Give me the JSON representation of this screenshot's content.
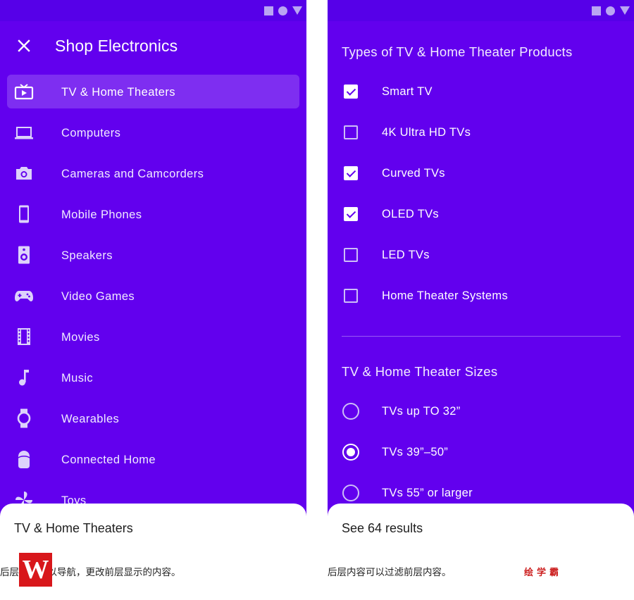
{
  "colors": {
    "primary": "#6200ee",
    "status_bar": "#5600e8",
    "sheet": "#ffffff",
    "watermark_red": "#d8171b"
  },
  "status_icons": [
    "square-icon",
    "circle-icon",
    "triangle-icon"
  ],
  "left_panel": {
    "title": "Shop Electronics",
    "close_icon": "close-icon",
    "nav_items": [
      {
        "label": "TV & Home Theaters",
        "icon": "tv-icon",
        "selected": true
      },
      {
        "label": "Computers",
        "icon": "laptop-icon",
        "selected": false
      },
      {
        "label": "Cameras and Camcorders",
        "icon": "camera-icon",
        "selected": false
      },
      {
        "label": "Mobile Phones",
        "icon": "phone-icon",
        "selected": false
      },
      {
        "label": "Speakers",
        "icon": "speaker-icon",
        "selected": false
      },
      {
        "label": "Video Games",
        "icon": "gamepad-icon",
        "selected": false
      },
      {
        "label": "Movies",
        "icon": "film-icon",
        "selected": false
      },
      {
        "label": "Music",
        "icon": "music-note-icon",
        "selected": false
      },
      {
        "label": "Wearables",
        "icon": "watch-icon",
        "selected": false
      },
      {
        "label": "Connected Home",
        "icon": "smart-speaker-icon",
        "selected": false
      },
      {
        "label": "Toys",
        "icon": "pinwheel-icon",
        "selected": false
      }
    ],
    "bottom_sheet": {
      "text": "TV & Home Theaters"
    },
    "caption": "后层内容可以导航，更改前层显示的内容。"
  },
  "right_panel": {
    "types_section": {
      "title": "Types of TV & Home Theater Products",
      "options": [
        {
          "label": "Smart TV",
          "checked": true
        },
        {
          "label": "4K Ultra HD TVs",
          "checked": false
        },
        {
          "label": "Curved TVs",
          "checked": true
        },
        {
          "label": "OLED TVs",
          "checked": true
        },
        {
          "label": "LED TVs",
          "checked": false
        },
        {
          "label": "Home Theater Systems",
          "checked": false
        }
      ]
    },
    "sizes_section": {
      "title": "TV & Home Theater Sizes",
      "options": [
        {
          "label": "TVs up TO 32”",
          "checked": false
        },
        {
          "label": "TVs 39”–50”",
          "checked": true
        },
        {
          "label": "TVs 55” or larger",
          "checked": false
        }
      ]
    },
    "bottom_sheet": {
      "text": "See 64 results"
    },
    "caption": "后层内容可以过滤前层内容。"
  },
  "logo": {
    "letter": "W"
  },
  "watermark": "绘学霸"
}
